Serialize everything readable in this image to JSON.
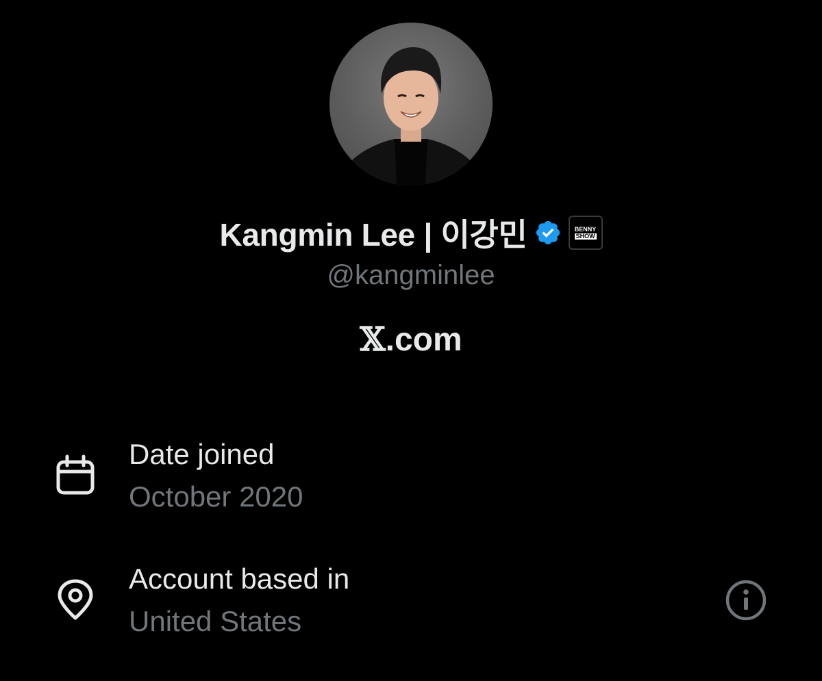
{
  "profile": {
    "display_name": "Kangmin Lee | 이강민",
    "handle": "@kangminlee",
    "verified_icon": "verified-checkmark-icon",
    "affiliate_badge": {
      "line1": "BENNY",
      "line2": "SHOW"
    }
  },
  "link": {
    "x_glyph": "𝕏",
    "domain": ".com"
  },
  "about": {
    "date_joined": {
      "icon": "calendar-icon",
      "title": "Date joined",
      "value": "October 2020"
    },
    "location": {
      "icon": "location-pin-icon",
      "title": "Account based in",
      "value": "United States",
      "info_icon": "info-icon"
    }
  },
  "colors": {
    "background": "#000000",
    "primary_text": "#e7e9ea",
    "secondary_text": "#71767b",
    "verified_blue": "#1d9bf0"
  }
}
